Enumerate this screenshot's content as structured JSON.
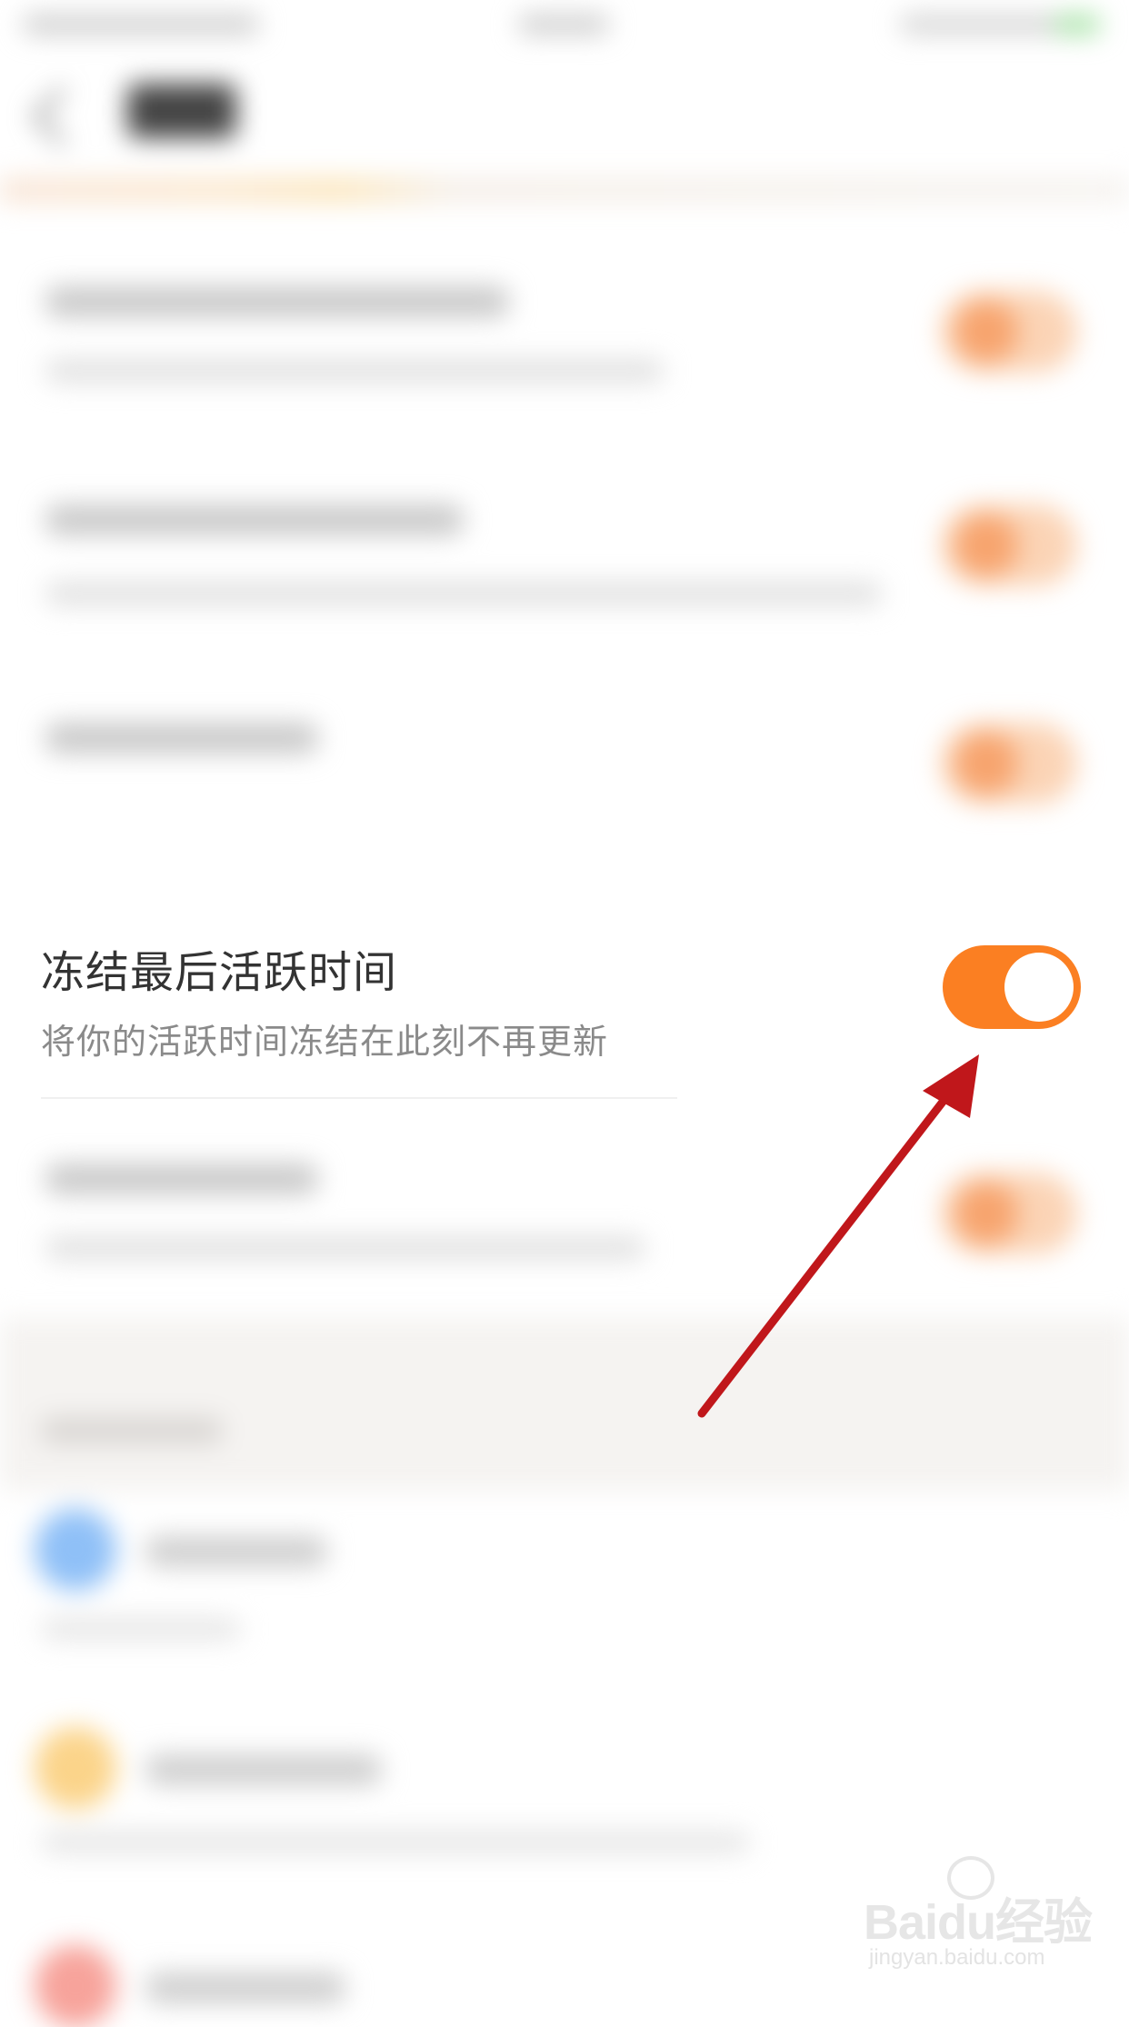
{
  "setting": {
    "title": "冻结最后活跃时间",
    "description": "将你的活跃时间冻结在此刻不再更新",
    "enabled": true
  },
  "colors": {
    "toggle_on": "#fb7f22",
    "arrow": "#c0171b",
    "title_text": "#333333",
    "desc_text": "#8a8a8a"
  },
  "watermark": {
    "logo": "Baidu经验",
    "url": "jingyan.baidu.com"
  }
}
